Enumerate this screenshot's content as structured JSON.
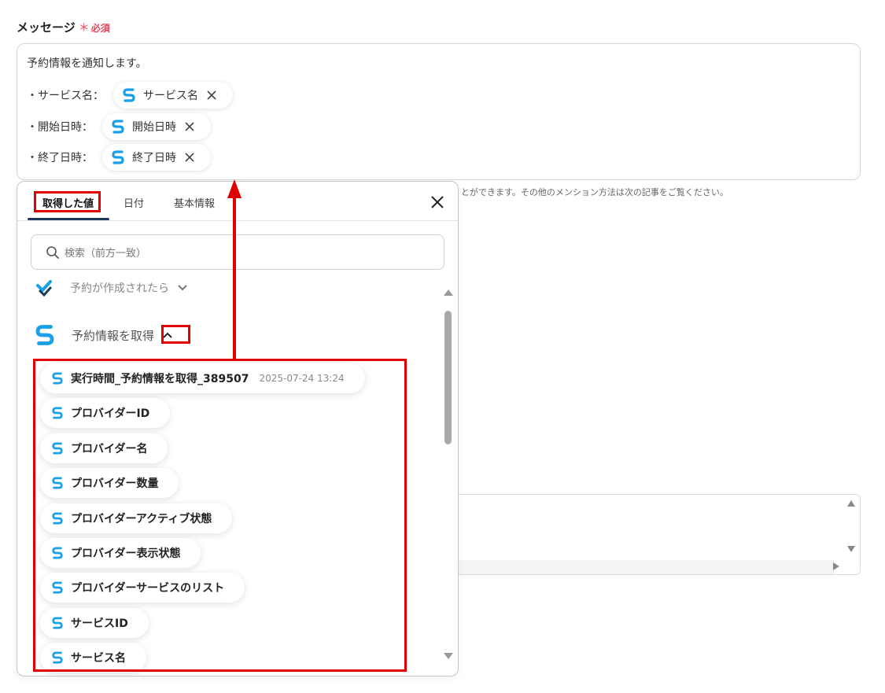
{
  "form": {
    "label": "メッセージ",
    "required_mark": "＊",
    "required_text": "必須"
  },
  "message": {
    "line0": "予約情報を通知します。",
    "rows": [
      {
        "label": "・サービス名：",
        "chip": "サービス名"
      },
      {
        "label": "・開始日時：",
        "chip": "開始日時"
      },
      {
        "label": "・終了日時：",
        "chip": "終了日時"
      }
    ]
  },
  "help_text": "とができます。その他のメンション方法は次の記事をご覧ください。",
  "popup": {
    "tabs": [
      "取得した値",
      "日付",
      "基本情報"
    ],
    "active_tab": 0,
    "search_placeholder": "検索（前方一致）",
    "groups": [
      {
        "label": "予約が作成されたら",
        "expanded": false
      },
      {
        "label": "予約情報を取得",
        "expanded": true
      }
    ],
    "items": [
      {
        "label": "実行時間_予約情報を取得_389507",
        "value": "2025-07-24 13:24"
      },
      {
        "label": "プロバイダーID"
      },
      {
        "label": "プロバイダー名"
      },
      {
        "label": "プロバイダー数量"
      },
      {
        "label": "プロバイダーアクティブ状態"
      },
      {
        "label": "プロバイダー表示状態"
      },
      {
        "label": "プロバイダーサービスのリスト"
      },
      {
        "label": "サービスID"
      },
      {
        "label": "サービス名"
      }
    ]
  },
  "colors": {
    "brand_icon": "#1aa0e6",
    "annotation": "#e00000",
    "required": "#e8455a",
    "tab_underline": "#1f3a5a"
  },
  "icons": {
    "app": "s-app-icon",
    "trigger": "check-app-icon",
    "close": "close-icon",
    "search": "search-icon",
    "chevron_down": "chevron-down-icon",
    "chevron_up": "chevron-up-icon"
  }
}
